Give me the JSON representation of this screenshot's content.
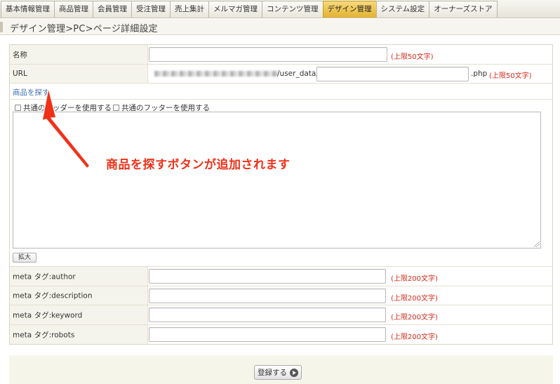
{
  "nav": {
    "tabs": [
      {
        "label": "基本情報管理"
      },
      {
        "label": "商品管理"
      },
      {
        "label": "会員管理"
      },
      {
        "label": "受注管理"
      },
      {
        "label": "売上集計"
      },
      {
        "label": "メルマガ管理"
      },
      {
        "label": "コンテンツ管理"
      },
      {
        "label": "デザイン管理"
      },
      {
        "label": "システム設定"
      },
      {
        "label": "オーナーズストア"
      }
    ],
    "active_tab": "デザイン管理"
  },
  "breadcrumb": "デザイン管理>PC>ページ詳細設定",
  "form": {
    "name": {
      "label": "名称",
      "value": "",
      "limit": "(上限50文字)"
    },
    "url": {
      "label": "URL",
      "prefix": "/user_data/",
      "value": "",
      "suffix": ".php",
      "limit": "(上限50文字)"
    },
    "search_product_link": "商品を探す",
    "use_common_header": "共通のヘッダーを使用する",
    "use_common_footer": "共通のフッターを使用する",
    "expand_button": "拡大",
    "meta_author": {
      "label": "meta タグ:author",
      "value": "",
      "limit": "(上限200文字)"
    },
    "meta_description": {
      "label": "meta タグ:description",
      "value": "",
      "limit": "(上限200文字)"
    },
    "meta_keyword": {
      "label": "meta タグ:keyword",
      "value": "",
      "limit": "(上限200文字)"
    },
    "meta_robots": {
      "label": "meta タグ:robots",
      "value": "",
      "limit": "(上限200文字)"
    }
  },
  "annotation": {
    "text": "商品を探すボタンが追加されます",
    "color": "#f03118"
  },
  "footer": {
    "submit_label": "登録する"
  },
  "colors": {
    "active_tab": "#e3b231",
    "limit_text": "#d22a1a",
    "link": "#3d6fb4"
  }
}
